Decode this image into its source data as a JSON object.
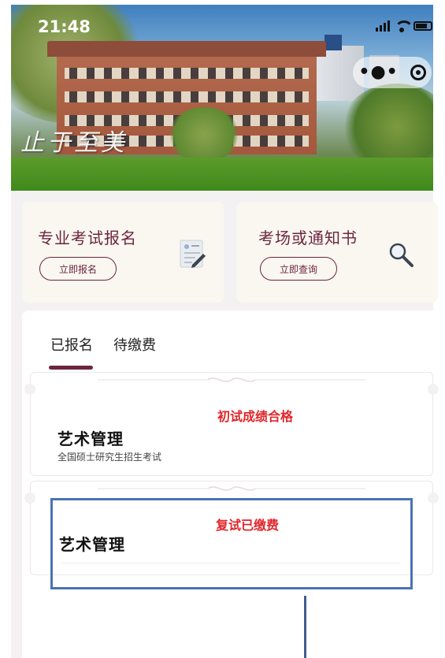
{
  "status_bar": {
    "time": "21:48",
    "icons": [
      "signal-icon",
      "wifi-icon",
      "battery-icon"
    ]
  },
  "hero": {
    "motto": "止于至美"
  },
  "capsule": {
    "icons": [
      "more-dots-icon",
      "close-target-icon"
    ]
  },
  "actions": [
    {
      "title": "专业考试报名",
      "button": "立即报名",
      "icon": "form-icon"
    },
    {
      "title": "考场或通知书",
      "button": "立即查询",
      "icon": "search-icon"
    }
  ],
  "tabs": [
    {
      "label": "已报名",
      "active": true
    },
    {
      "label": "待缴费",
      "active": false
    }
  ],
  "records": [
    {
      "status": "初试成绩合格",
      "subject": "艺术管理",
      "exam_type": "全国硕士研究生招生考试"
    },
    {
      "status": "复试已缴费",
      "subject": "艺术管理"
    }
  ],
  "colors": {
    "brand": "#6b2540",
    "status_red": "#e0262b",
    "highlight": "#4a73b8",
    "card_bg": "#f9f7f0",
    "page_bg": "#f3f1f2"
  }
}
